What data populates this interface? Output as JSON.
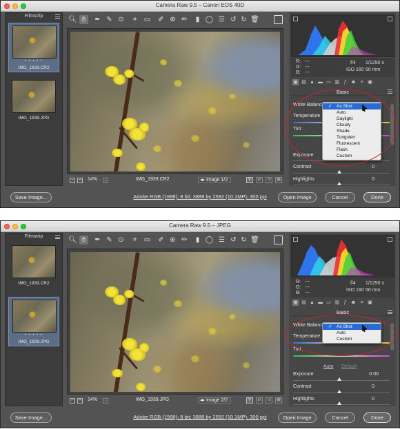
{
  "colors": {
    "accent": "#2a6bd3",
    "highlight_ring": "#c62828",
    "panel_bg": "#535353"
  },
  "windows": [
    {
      "title": "Camera Raw 9.5  –  Canon EOS 40D",
      "filmstrip": {
        "header": "Filmstrip",
        "items": [
          {
            "name": "IMG_1939.CR2",
            "dots": "• • • • •",
            "selected": true
          },
          {
            "name": "IMG_1939.JPG",
            "selected": false
          }
        ]
      },
      "preview": {
        "zoom": "14%",
        "filename": "IMG_1939.CR2",
        "image_index": "Image 1/2",
        "y_label": "Y"
      },
      "readout": {
        "r": "R:",
        "g": "G:",
        "b": "B:",
        "r_val": "---",
        "g_val": "---",
        "b_val": "---",
        "aperture": "f/4",
        "shutter": "1/1250 s",
        "iso": "ISO 160",
        "focal": "50 mm"
      },
      "basic": {
        "title": "Basic",
        "wb_label": "White Balance",
        "wb_options": [
          "As Shot",
          "Auto",
          "Daylight",
          "Cloudy",
          "Shade",
          "Tungsten",
          "Fluorescent",
          "Flash",
          "Custom"
        ],
        "wb_selected": "As Shot",
        "temp_label": "Temperature",
        "tint_label": "Tint",
        "exposure_label": "Exposure",
        "contrast_label": "Contrast",
        "contrast_value": "0",
        "highlights_label": "Highlights",
        "highlights_value": "0"
      },
      "footer": {
        "save": "Save Image...",
        "workflow": "Adobe RGB (1998); 8 bit; 3888 by 2592 (10.1MP); 300 ppi",
        "open": "Open Image",
        "cancel": "Cancel",
        "done": "Done"
      }
    },
    {
      "title": "Camera Raw 9.5  –  JPEG",
      "filmstrip": {
        "header": "Filmstrip",
        "items": [
          {
            "name": "IMG_1939.CR2",
            "selected": false
          },
          {
            "name": "IMG_1939.JPG",
            "dots": "• • • • •",
            "selected": true
          }
        ]
      },
      "preview": {
        "zoom": "14%",
        "filename": "IMG_1939.JPG",
        "image_index": "Image 2/2",
        "y_label": "Y"
      },
      "readout": {
        "r": "R:",
        "g": "G:",
        "b": "B:",
        "r_val": "---",
        "g_val": "---",
        "b_val": "---",
        "aperture": "f/4",
        "shutter": "1/1250 s",
        "iso": "ISO 160",
        "focal": "50 mm"
      },
      "basic": {
        "title": "Basic",
        "wb_label": "White Balance",
        "wb_options": [
          "As Shot",
          "Auto",
          "Custom"
        ],
        "wb_selected": "As Shot",
        "temp_label": "Temperature",
        "tint_label": "Tint",
        "auto_link": "Auto",
        "default_link": "Default",
        "exposure_label": "Exposure",
        "exposure_value": "0.00",
        "contrast_label": "Contrast",
        "contrast_value": "0",
        "highlights_label": "Highlights",
        "highlights_value": "0"
      },
      "footer": {
        "save": "Save Image...",
        "workflow": "Adobe RGB (1998); 8 bit; 3888 by 2592 (10.1MP); 300 ppi",
        "open": "Open Image",
        "cancel": "Cancel",
        "done": "Done"
      }
    }
  ]
}
